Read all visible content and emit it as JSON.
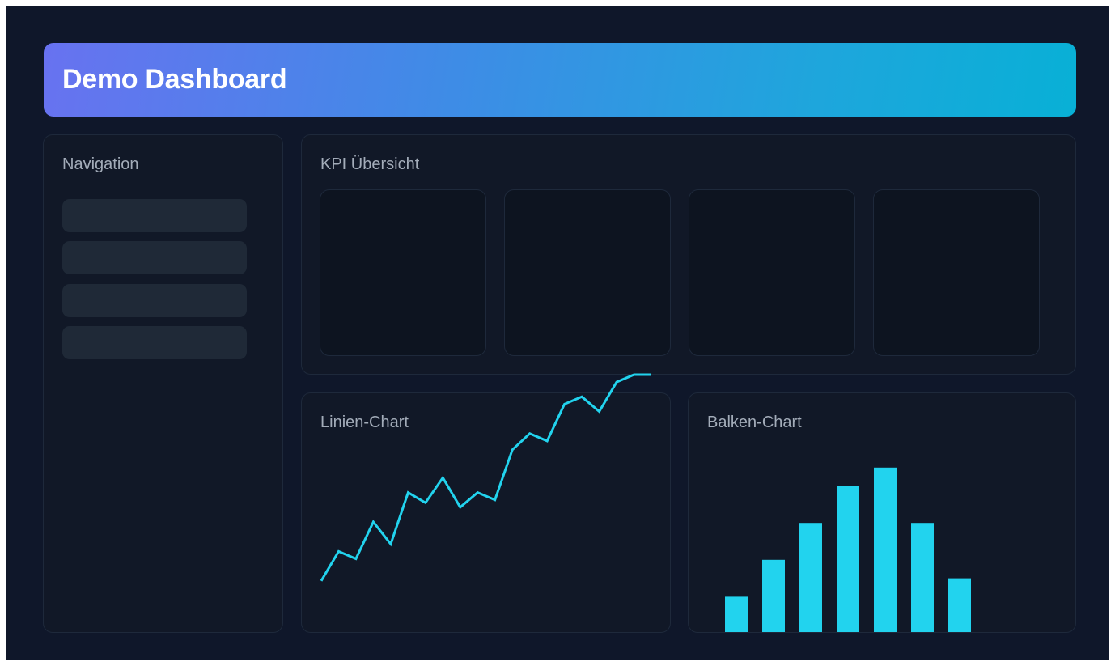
{
  "header": {
    "title": "Demo Dashboard",
    "gradient": [
      "#6872f0",
      "#3e8ce6",
      "#1ea6dc",
      "#08b0d6"
    ]
  },
  "colors": {
    "background": "#0f172a",
    "panel": "#111827",
    "panel_border": "#1e293b",
    "nav_item": "#1f2937",
    "kpi_card": "#0d1420",
    "chart_accent": "#22d3ee",
    "muted_text": "#a3acb9"
  },
  "sidebar": {
    "title": "Navigation",
    "items": [
      {
        "label": ""
      },
      {
        "label": ""
      },
      {
        "label": ""
      },
      {
        "label": ""
      }
    ]
  },
  "kpi": {
    "title": "KPI Übersicht",
    "cards": [
      {
        "value": ""
      },
      {
        "value": ""
      },
      {
        "value": ""
      },
      {
        "value": ""
      }
    ]
  },
  "line_chart_panel": {
    "title": "Linien-Chart"
  },
  "bar_chart_panel": {
    "title": "Balken-Chart"
  },
  "chart_data": [
    {
      "type": "line",
      "title": "Linien-Chart",
      "xlabel": "",
      "ylabel": "",
      "x": [
        1,
        2,
        3,
        4,
        5,
        6,
        7,
        8,
        9,
        10,
        11,
        12,
        13,
        14,
        15,
        16,
        17,
        18,
        19,
        20
      ],
      "series": [
        {
          "values": [
            10,
            30,
            25,
            50,
            35,
            70,
            63,
            80,
            60,
            70,
            65,
            99,
            110,
            105,
            130,
            135,
            125,
            145,
            150,
            150
          ]
        }
      ],
      "ylim": [
        0,
        150
      ],
      "grid": false
    },
    {
      "type": "bar",
      "title": "Balken-Chart",
      "xlabel": "",
      "ylabel": "",
      "categories": [
        "",
        "",
        "",
        "",
        "",
        "",
        ""
      ],
      "values": [
        20,
        40,
        60,
        80,
        90,
        60,
        30
      ],
      "ylim": [
        0,
        100
      ],
      "grid": false
    }
  ]
}
